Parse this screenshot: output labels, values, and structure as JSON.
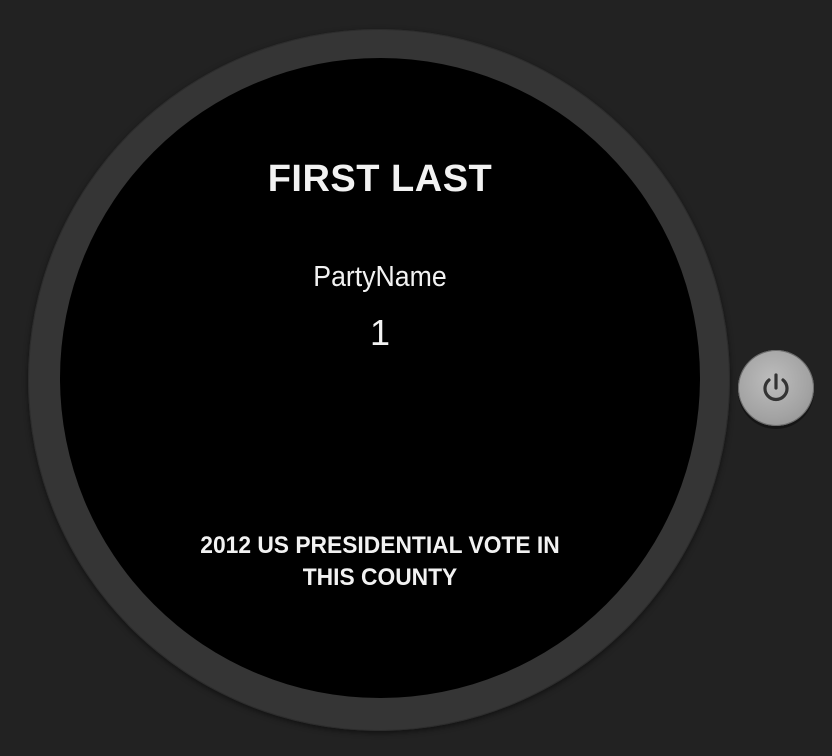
{
  "candidate": {
    "name": "FIRST LAST",
    "party": "PartyName",
    "votes": "1"
  },
  "caption": {
    "line1": "2012 US PRESIDENTIAL VOTE IN",
    "line2": "THIS COUNTY"
  },
  "controls": {
    "power_icon": "power-icon"
  },
  "colors": {
    "background": "#222222",
    "bezel": "#353535",
    "face": "#000000",
    "text": "#f2f2f2",
    "button": "#a8a8a8"
  }
}
